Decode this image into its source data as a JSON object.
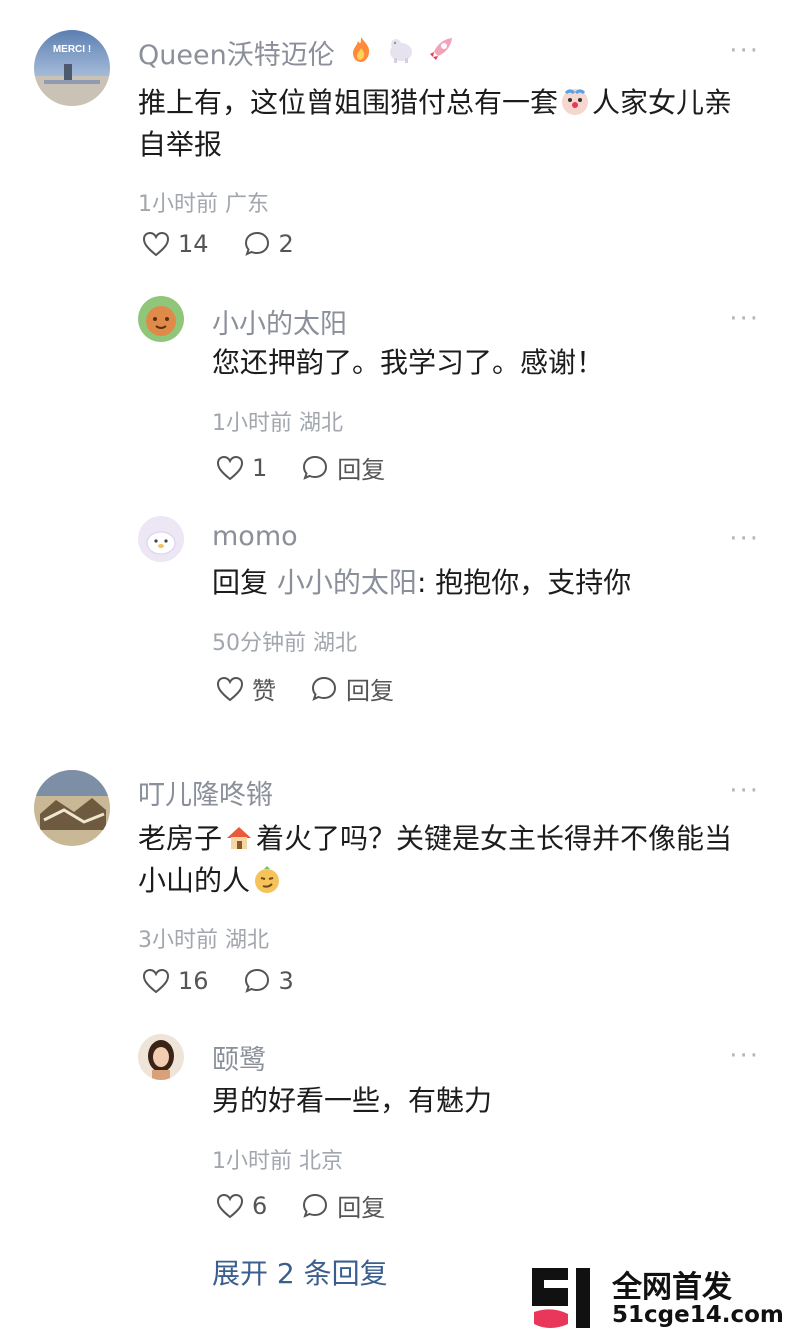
{
  "comments": [
    {
      "user": "Queen沃特迈伦",
      "text_a": "推上有，这位曾姐围猎付总有一套",
      "text_b": "人家女儿亲自举报",
      "time": "1小时前",
      "location": "广东",
      "likes": "14",
      "replies": "2",
      "avatar_label": "MERCI !",
      "badge_icons": [
        "fire-icon",
        "cat-icon",
        "rocket-icon"
      ],
      "inline_emoji": "clown-face-icon"
    },
    {
      "user": "小小的太阳",
      "text": "您还押韵了。我学习了。感谢！",
      "time": "1小时前",
      "location": "湖北",
      "likes": "1",
      "reply_label": "回复"
    },
    {
      "user": "momo",
      "reply_prefix": "回复",
      "mention": "小小的太阳",
      "text": ": 抱抱你，支持你",
      "time": "50分钟前",
      "location": "湖北",
      "likes": "赞",
      "reply_label": "回复"
    },
    {
      "user": "叮儿隆咚锵",
      "text_a": "老房子",
      "text_b": "着火了吗？关键是女主长得并不像能当小山的人",
      "time": "3小时前",
      "location": "湖北",
      "likes": "16",
      "replies": "3",
      "inline_emojis": [
        "house-icon",
        "smirk-face-icon"
      ]
    },
    {
      "user": "颐鹭",
      "text": "男的好看一些，有魅力",
      "time": "1小时前",
      "location": "北京",
      "likes": "6",
      "reply_label": "回复"
    }
  ],
  "expand_label": "展开 2 条回复",
  "more_label": "···",
  "watermark": {
    "line1": "全网首发",
    "line2": "51cge14.com",
    "logo_colors": [
      "#111111",
      "#e8375a"
    ]
  },
  "colors": {
    "username": "#8a8f99",
    "meta": "#a2a6ad",
    "link": "#3a5f8f"
  }
}
